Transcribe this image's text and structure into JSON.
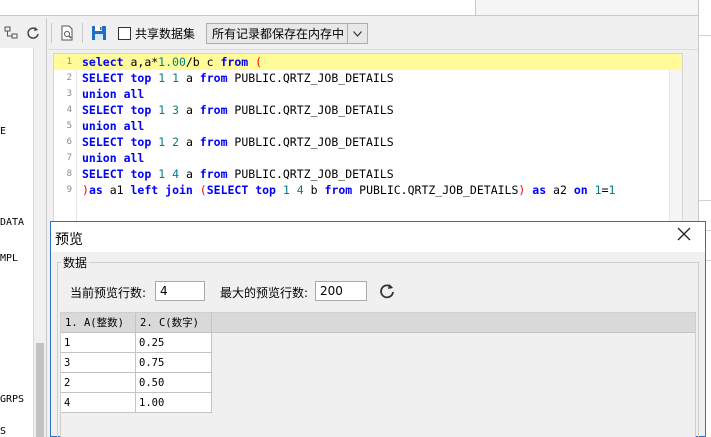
{
  "toolbar": {
    "share_label": "共享数据集",
    "mode_value": "所有记录都保存在内存中",
    "icons": [
      "preview-icon",
      "save-icon",
      "checkbox",
      "chevron-down-icon"
    ]
  },
  "left_panel": {
    "icons": [
      "tree-icon",
      "refresh-icon"
    ],
    "items": [
      "E",
      "DATA",
      "MPL",
      "GRPS",
      "S"
    ]
  },
  "editor": {
    "lines": [
      {
        "n": "1",
        "tokens": [
          [
            "kw",
            "select"
          ],
          [
            "id",
            " a,a*"
          ],
          [
            "num",
            "1.00"
          ],
          [
            "id",
            "/b c "
          ],
          [
            "kw",
            "from"
          ],
          [
            "id",
            " "
          ],
          [
            "par",
            "("
          ]
        ]
      },
      {
        "n": "2",
        "tokens": [
          [
            "kw",
            "SELECT"
          ],
          [
            "id",
            " "
          ],
          [
            "kw",
            "top"
          ],
          [
            "id",
            " "
          ],
          [
            "num",
            "1"
          ],
          [
            "id",
            " "
          ],
          [
            "num",
            "1"
          ],
          [
            "id",
            " a "
          ],
          [
            "kw",
            "from"
          ],
          [
            "id",
            " PUBLIC.QRTZ_JOB_DETAILS"
          ]
        ]
      },
      {
        "n": "3",
        "tokens": [
          [
            "kw",
            "union"
          ],
          [
            "id",
            " "
          ],
          [
            "kw",
            "all"
          ]
        ]
      },
      {
        "n": "4",
        "tokens": [
          [
            "kw",
            "SELECT"
          ],
          [
            "id",
            " "
          ],
          [
            "kw",
            "top"
          ],
          [
            "id",
            " "
          ],
          [
            "num",
            "1"
          ],
          [
            "id",
            " "
          ],
          [
            "num",
            "3"
          ],
          [
            "id",
            " a "
          ],
          [
            "kw",
            "from"
          ],
          [
            "id",
            " PUBLIC.QRTZ_JOB_DETAILS"
          ]
        ]
      },
      {
        "n": "5",
        "tokens": [
          [
            "kw",
            "union"
          ],
          [
            "id",
            " "
          ],
          [
            "kw",
            "all"
          ]
        ]
      },
      {
        "n": "6",
        "tokens": [
          [
            "kw",
            "SELECT"
          ],
          [
            "id",
            " "
          ],
          [
            "kw",
            "top"
          ],
          [
            "id",
            " "
          ],
          [
            "num",
            "1"
          ],
          [
            "id",
            " "
          ],
          [
            "num",
            "2"
          ],
          [
            "id",
            " a "
          ],
          [
            "kw",
            "from"
          ],
          [
            "id",
            " PUBLIC.QRTZ_JOB_DETAILS"
          ]
        ]
      },
      {
        "n": "7",
        "tokens": [
          [
            "kw",
            "union"
          ],
          [
            "id",
            " "
          ],
          [
            "kw",
            "all"
          ]
        ]
      },
      {
        "n": "8",
        "tokens": [
          [
            "kw",
            "SELECT"
          ],
          [
            "id",
            " "
          ],
          [
            "kw",
            "top"
          ],
          [
            "id",
            " "
          ],
          [
            "num",
            "1"
          ],
          [
            "id",
            " "
          ],
          [
            "num",
            "4"
          ],
          [
            "id",
            " a "
          ],
          [
            "kw",
            "from"
          ],
          [
            "id",
            " PUBLIC.QRTZ_JOB_DETAILS"
          ]
        ]
      },
      {
        "n": "9",
        "tokens": [
          [
            "par",
            ")"
          ],
          [
            "kw",
            "as"
          ],
          [
            "id",
            " a1 "
          ],
          [
            "kw",
            "left"
          ],
          [
            "id",
            " "
          ],
          [
            "kw",
            "join"
          ],
          [
            "id",
            " "
          ],
          [
            "par",
            "("
          ],
          [
            "kw",
            "SELECT"
          ],
          [
            "id",
            " "
          ],
          [
            "kw",
            "top"
          ],
          [
            "id",
            " "
          ],
          [
            "num",
            "1"
          ],
          [
            "id",
            " "
          ],
          [
            "num",
            "4"
          ],
          [
            "id",
            " b "
          ],
          [
            "kw",
            "from"
          ],
          [
            "id",
            " PUBLIC.QRTZ_JOB_DETAILS"
          ],
          [
            "par",
            ")"
          ],
          [
            "id",
            " "
          ],
          [
            "kw",
            "as"
          ],
          [
            "id",
            " a2 "
          ],
          [
            "kw",
            "on"
          ],
          [
            "id",
            " "
          ],
          [
            "num",
            "1"
          ],
          [
            "id",
            "="
          ],
          [
            "num",
            "1"
          ]
        ]
      }
    ]
  },
  "dialog": {
    "title": "预览",
    "group_label": "数据",
    "current_rows_label": "当前预览行数:",
    "current_rows_value": "4",
    "max_rows_label": "最大的预览行数:",
    "max_rows_value": "200"
  },
  "grid": {
    "headers": [
      "1. A(整数)",
      "2. C(数字)"
    ],
    "rows": [
      [
        "1",
        "0.25"
      ],
      [
        "3",
        "0.75"
      ],
      [
        "2",
        "0.50"
      ],
      [
        "4",
        "1.00"
      ]
    ]
  }
}
